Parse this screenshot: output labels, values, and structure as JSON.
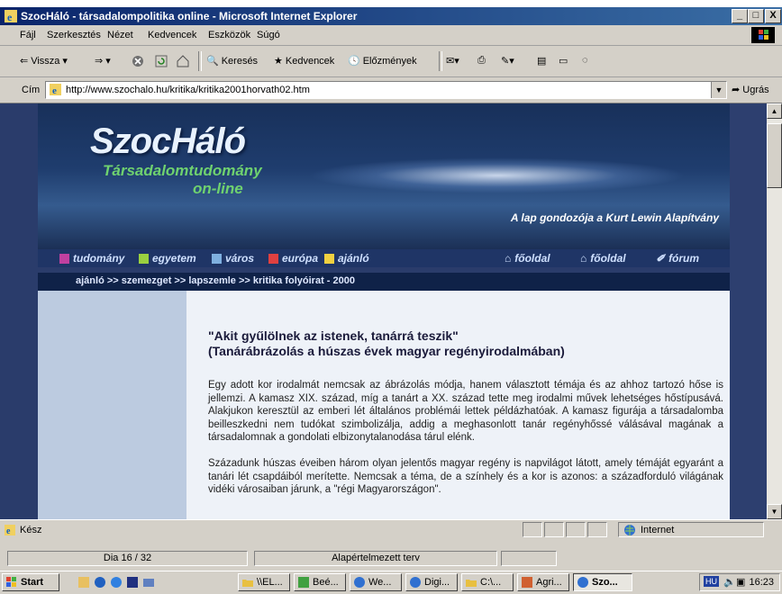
{
  "window": {
    "title": "SzocHáló - társadalompolitika online - Microsoft Internet Explorer",
    "min": "_",
    "max": "□",
    "close": "X"
  },
  "menu": [
    "Fájl",
    "Szerkesztés",
    "Nézet",
    "Kedvencek",
    "Eszközök",
    "Súgó"
  ],
  "toolbar": {
    "back": "Vissza",
    "search": "Keresés",
    "favorites": "Kedvencek",
    "history": "Előzmények"
  },
  "address": {
    "label": "Cím",
    "url": "http://www.szochalo.hu/kritika/kritika2001horvath02.htm",
    "go": "Ugrás"
  },
  "banner": {
    "logo_main": "SzocHáló",
    "logo_sub1": "Társadalomtudomány",
    "logo_sub2": "on-line",
    "slogan": "A lap gondozója a Kurt Lewin Alapítvány"
  },
  "nav": {
    "items": [
      {
        "label": "tudomány",
        "color": "#c040a0"
      },
      {
        "label": "egyetem",
        "color": "#9ad040"
      },
      {
        "label": "város",
        "color": "#7fb0e0"
      },
      {
        "label": "európa",
        "color": "#e04040"
      },
      {
        "label": "ajánló",
        "color": "#f0d040"
      }
    ],
    "right": [
      "főoldal",
      "főoldal",
      "fórum"
    ]
  },
  "breadcrumb": "ajánló >> szemezget >> lapszemle >> kritika folyóirat - 2000",
  "article": {
    "title_line1": "\"Akit gyűlölnek az istenek, tanárrá teszik\"",
    "title_line2": "(Tanárábrázolás a húszas évek magyar regényirodalmában)",
    "para1": "Egy adott kor irodalmát nemcsak az ábrázolás módja, hanem választott témája és az ahhoz tartozó hőse is jellemzi. A kamasz XIX. század, míg a tanárt a XX. század tette meg irodalmi művek lehetséges hőstípusává. Alakjukon keresztül az emberi lét általános problémái lettek példázhatóak. A kamasz figurája a társadalomba beilleszkedni nem tudókat szimbolizálja, addig a meghasonlott tanár regényhőssé válásával magának a társadalomnak a gondolati elbizonytalanodása tárul elénk.",
    "para2": "Századunk húszas éveiben három olyan jelentős magyar regény is napvilágot látott, amely témáját egyaránt a tanári lét csapdáiból merítette. Nemcsak a téma, de a színhely és a kor is azonos: a századforduló világának vidéki városaiban járunk, a \"régi Magyarországon\"."
  },
  "status": {
    "left": "Kész",
    "zone": "Internet"
  },
  "ppt": {
    "slide": "Dia 16 / 32",
    "design": "Alapértelmezett terv"
  },
  "taskbar": {
    "start": "Start",
    "tasks": [
      "\\\\EL...",
      "Beé...",
      "We...",
      "Digi...",
      "C:\\...",
      "Agri...",
      "Szo..."
    ],
    "lang": "HU",
    "clock": "16:23"
  }
}
